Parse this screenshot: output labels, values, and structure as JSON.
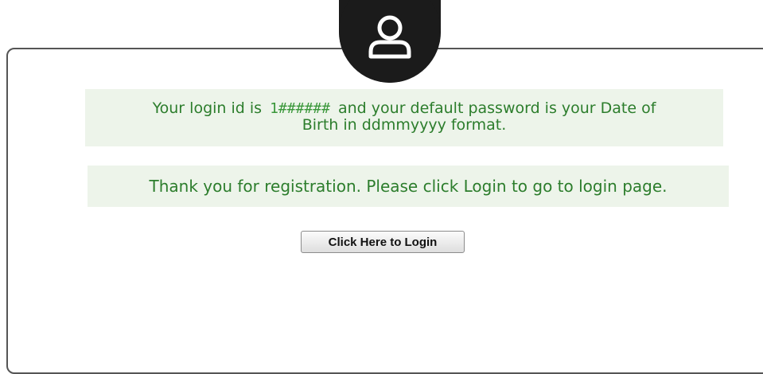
{
  "icons": {
    "avatar": "user-icon"
  },
  "colors": {
    "notice_background": "#edf4ea",
    "notice_text": "#2c7d2c",
    "card_border": "#555555",
    "avatar_background": "#1b1b1b"
  },
  "login_notice": {
    "prefix": "Your login id is",
    "login_id": "1######",
    "line1_suffix": "and your default password is your Date of",
    "line2": "Birth in ddmmyyyy format."
  },
  "thanks_notice": {
    "text": "Thank you for registration. Please click Login to go to login page."
  },
  "login_button": {
    "label": "Click Here to Login"
  }
}
